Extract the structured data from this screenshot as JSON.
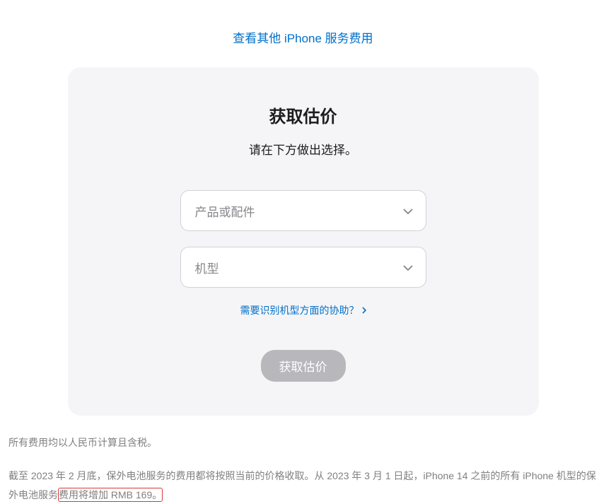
{
  "topLink": {
    "label": "查看其他 iPhone 服务费用"
  },
  "card": {
    "title": "获取估价",
    "subtitle": "请在下方做出选择。",
    "select1": {
      "placeholder": "产品或配件"
    },
    "select2": {
      "placeholder": "机型"
    },
    "helpLink": {
      "label": "需要识别机型方面的协助？"
    },
    "submitButton": {
      "label": "获取估价"
    }
  },
  "footer": {
    "line1": "所有费用均以人民币计算且含税。",
    "line2_part1": "截至 2023 年 2 月底，保外电池服务的费用都将按照当前的价格收取。从 2023 年 3 月 1 日起，iPhone 14 之前的所有 iPhone 机型的保外电池服务",
    "line2_highlight": "费用将增加 RMB 169。"
  }
}
